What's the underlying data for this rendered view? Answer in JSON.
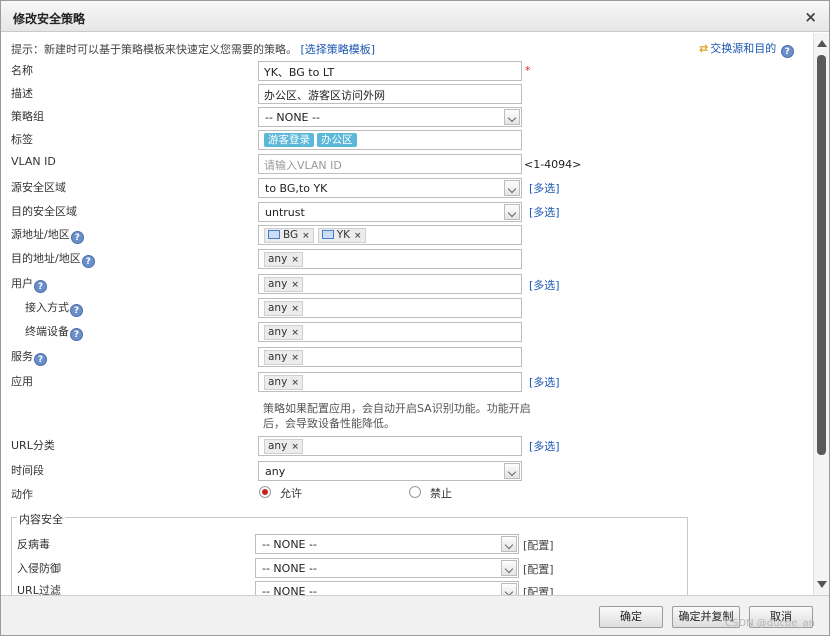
{
  "dialog": {
    "title": "修改安全策略",
    "close": "×"
  },
  "tip": {
    "text": "提示：新建时可以基于策略模板来快速定义您需要的策略。",
    "link": "[选择策略模板]"
  },
  "swap": {
    "icon": "⇄",
    "text": "交换源和目的"
  },
  "help_glyph": "?",
  "required_mark": "*",
  "multi_link": "[多选]",
  "config_link": "[配置]",
  "chip_remove": "×",
  "fields": {
    "name": {
      "label": "名称",
      "value": "YK、BG to LT"
    },
    "desc": {
      "label": "描述",
      "value": "办公区、游客区访问外网"
    },
    "group": {
      "label": "策略组",
      "value": "-- NONE --"
    },
    "tags": {
      "label": "标签",
      "items": [
        "游客登录",
        "办公区"
      ]
    },
    "vlan": {
      "label": "VLAN ID",
      "placeholder": "请输入VLAN ID",
      "range": "<1-4094>"
    },
    "src_zone": {
      "label": "源安全区域",
      "value": "to BG,to YK"
    },
    "dst_zone": {
      "label": "目的安全区域",
      "value": "untrust"
    },
    "src_addr": {
      "label": "源地址/地区",
      "items": [
        "BG",
        "YK"
      ]
    },
    "dst_addr": {
      "label": "目的地址/地区",
      "items": [
        "any"
      ]
    },
    "user": {
      "label": "用户",
      "items": [
        "any"
      ]
    },
    "access": {
      "label": "接入方式",
      "items": [
        "any"
      ]
    },
    "terminal": {
      "label": "终端设备",
      "items": [
        "any"
      ]
    },
    "service": {
      "label": "服务",
      "items": [
        "any"
      ]
    },
    "app": {
      "label": "应用",
      "items": [
        "any"
      ]
    },
    "app_note": "策略如果配置应用，会自动开启SA识别功能。功能开启后，会导致设备性能降低。",
    "url_cat": {
      "label": "URL分类",
      "items": [
        "any"
      ]
    },
    "time": {
      "label": "时间段",
      "value": "any"
    },
    "action": {
      "label": "动作",
      "allow": "允许",
      "deny": "禁止",
      "selected": "allow"
    }
  },
  "content_security": {
    "legend": "内容安全",
    "antivirus": {
      "label": "反病毒",
      "value": "-- NONE --"
    },
    "ips": {
      "label": "入侵防御",
      "value": "-- NONE --"
    },
    "url_filter": {
      "label": "URL过滤",
      "value": "-- NONE --"
    }
  },
  "buttons": {
    "ok": "确定",
    "ok_copy": "确定并复制",
    "cancel": "取消"
  },
  "watermark": "CSDN @ducbe_an"
}
